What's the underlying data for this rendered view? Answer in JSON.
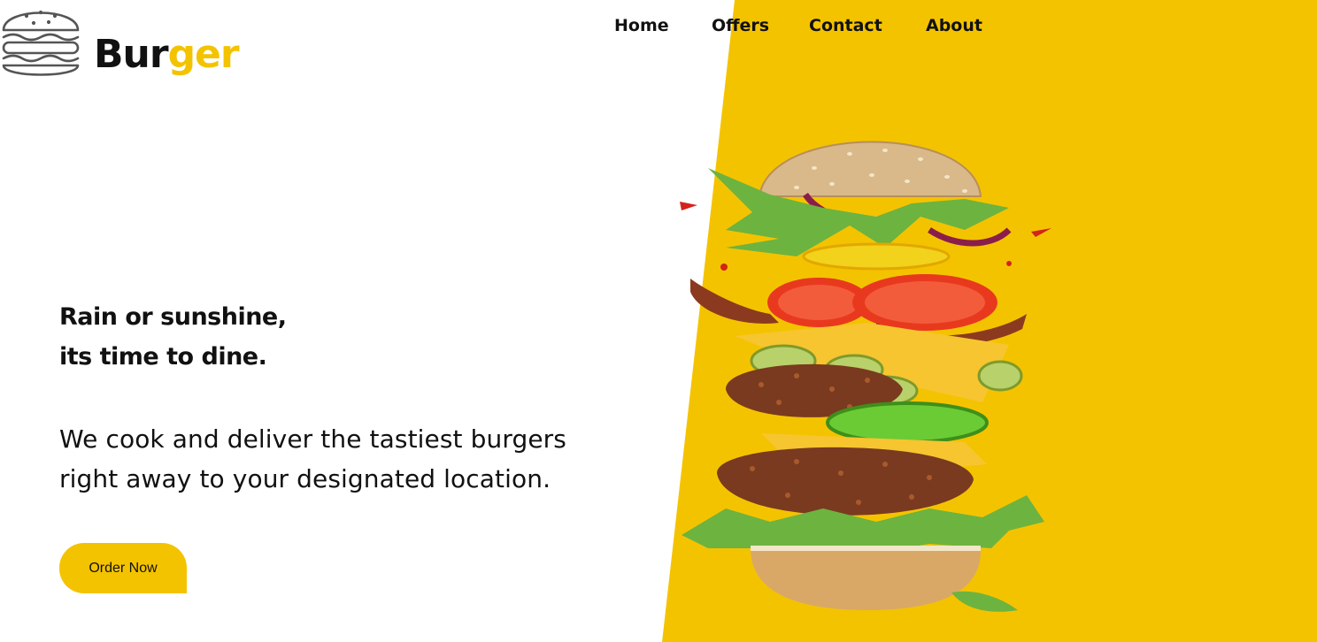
{
  "brand": {
    "name_part1": "Bur",
    "name_part2": "ger",
    "logo_icon": "burger-outline-icon",
    "accent_color": "#F4C300"
  },
  "nav": {
    "items": [
      {
        "label": "Home"
      },
      {
        "label": "Offers"
      },
      {
        "label": "Contact"
      },
      {
        "label": "About"
      }
    ]
  },
  "hero": {
    "headline_line1": "Rain or sunshine,",
    "headline_line2": "its time to dine.",
    "description_line1": "We cook and deliver the tastiest burgers",
    "description_line2": "right away to your designated location.",
    "cta_label": "Order Now",
    "image": "flying-burger-image"
  },
  "colors": {
    "accent": "#F4C300",
    "text": "#111111",
    "background": "#ffffff"
  }
}
